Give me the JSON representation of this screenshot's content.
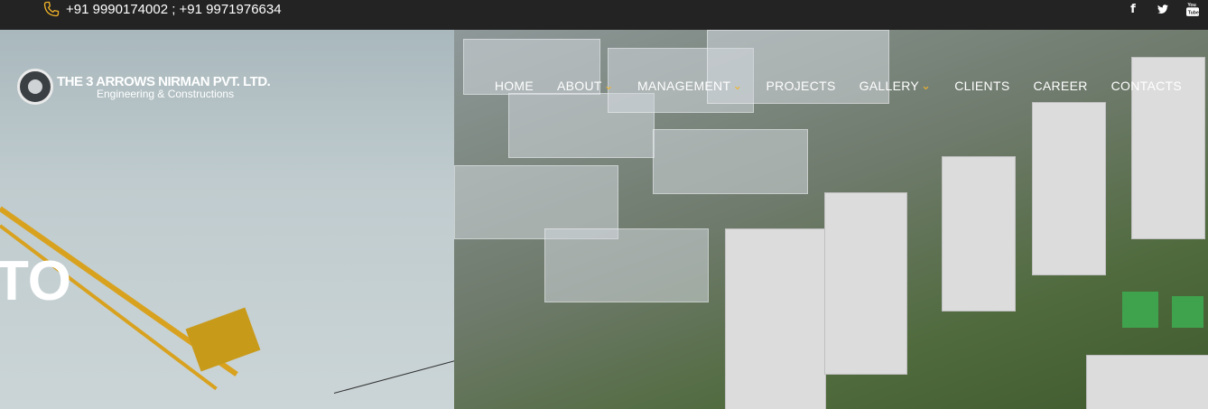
{
  "topbar": {
    "phone": "+91 9990174002 ; +91 9971976634",
    "social_icons": [
      "facebook-icon",
      "twitter-icon",
      "youtube-icon"
    ]
  },
  "logo": {
    "brand": "THE 3 ARROWS NIRMAN PVT. LTD.",
    "tagline": "Engineering & Constructions"
  },
  "nav": {
    "items": [
      {
        "label": "HOME",
        "dropdown": false
      },
      {
        "label": "ABOUT",
        "dropdown": true
      },
      {
        "label": "MANAGEMENT",
        "dropdown": true
      },
      {
        "label": "PROJECTS",
        "dropdown": false
      },
      {
        "label": "GALLERY",
        "dropdown": true
      },
      {
        "label": "CLIENTS",
        "dropdown": false
      },
      {
        "label": "CAREER",
        "dropdown": false
      },
      {
        "label": "CONTACTS",
        "dropdown": false
      }
    ],
    "chevron": "⌄"
  },
  "hero": {
    "headline_fragment": "TO"
  },
  "colors": {
    "accent": "#f0b429",
    "topbar": "#232323"
  }
}
